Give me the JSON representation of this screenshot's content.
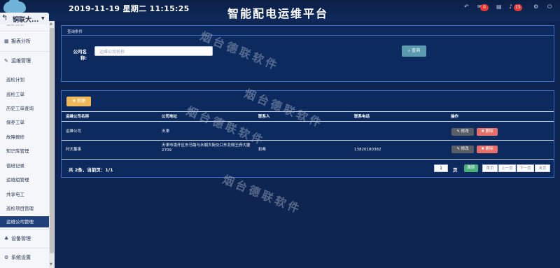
{
  "header": {
    "datetime": "2019-11-19 星期二 11:15:25",
    "title": "智能配电运维平台",
    "icons": [
      {
        "name": "back-icon",
        "glyph": "↶"
      },
      {
        "name": "alarm-icon",
        "glyph": "✉",
        "badge": "0"
      },
      {
        "name": "calendar-icon",
        "glyph": "▤"
      },
      {
        "name": "bell-icon",
        "glyph": "♪",
        "badge": "15"
      },
      {
        "name": "gear-icon",
        "glyph": "⚙"
      },
      {
        "name": "power-icon",
        "glyph": "⏻"
      }
    ]
  },
  "org": {
    "name": "铜联大..."
  },
  "sidebar": {
    "partial_top": "统计分析",
    "items": [
      {
        "label": "报表分析",
        "type": "section",
        "icon": "▦"
      },
      {
        "label": "运维管理",
        "type": "section",
        "icon": "✎"
      },
      {
        "label": "巡检计划"
      },
      {
        "label": "巡检工单"
      },
      {
        "label": "历史工单查询"
      },
      {
        "label": "保养工单"
      },
      {
        "label": "故障报修"
      },
      {
        "label": "知识库管理"
      },
      {
        "label": "值班记录"
      },
      {
        "label": "运维组管理"
      },
      {
        "label": "共享电工"
      },
      {
        "label": "巡检项目管理"
      },
      {
        "label": "运维公司管理",
        "active": true
      },
      {
        "label": "设备管理",
        "type": "section",
        "icon": "♣"
      },
      {
        "label": "系统设置",
        "type": "section",
        "icon": "⚙"
      }
    ]
  },
  "query": {
    "title": "查询条件",
    "company_label": "公司名称:",
    "company_placeholder": "运维公司名称",
    "query_button": "查询"
  },
  "table": {
    "new_button": "新建",
    "columns": [
      "运维公司名称",
      "公司地址",
      "联系人",
      "联系电话",
      "操作"
    ],
    "rows": [
      {
        "name": "运维公司",
        "address": "天津",
        "contact": "",
        "phone": ""
      },
      {
        "name": "时天董事",
        "address": "天津市南开区东马路与水阁大街交口东北侧王府大厦2709",
        "contact": "彩希",
        "phone": "13820180382"
      }
    ],
    "edit_label": "修改",
    "delete_label": "删除",
    "summary": "共 2条，当前页：1/1",
    "page_value": "1",
    "page_unit": "页",
    "jump_label": "跳转",
    "pager": [
      "首页",
      "上一页",
      "下一页",
      "末页"
    ]
  },
  "watermark": "烟台德联软件"
}
